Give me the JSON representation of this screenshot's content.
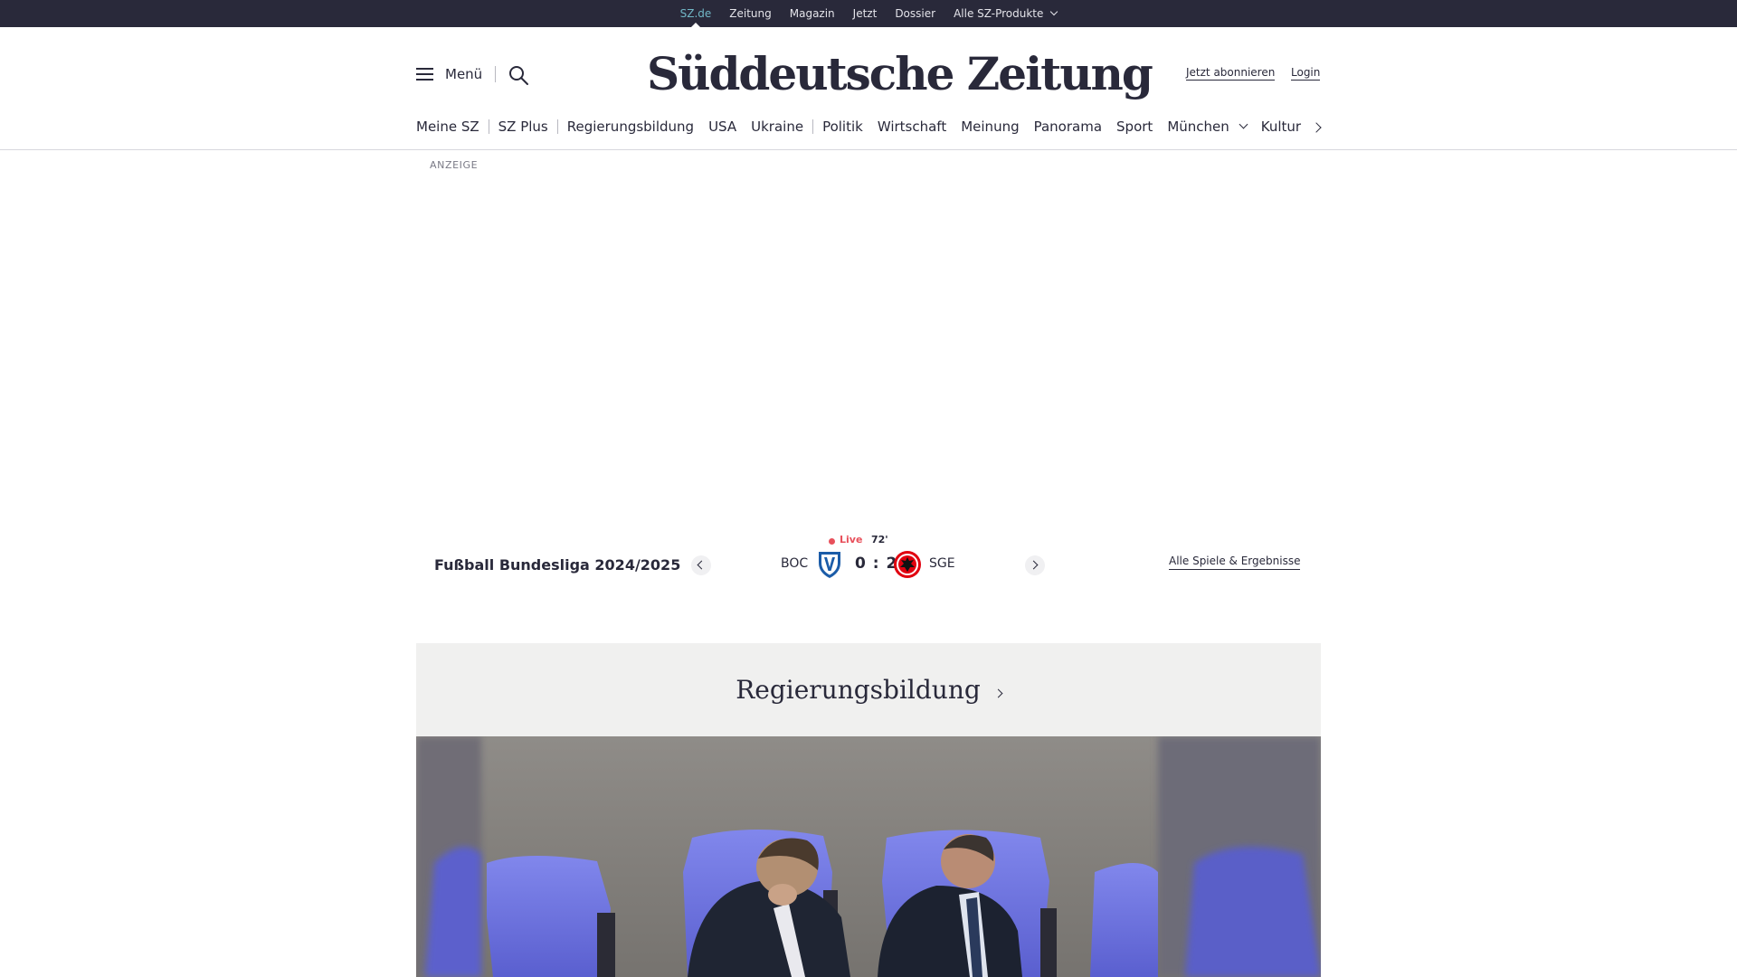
{
  "topbar": {
    "links": [
      {
        "label": "SZ.de"
      },
      {
        "label": "Zeitung"
      },
      {
        "label": "Magazin"
      },
      {
        "label": "Jetzt"
      },
      {
        "label": "Dossier"
      },
      {
        "label": "Alle SZ-Produkte"
      }
    ]
  },
  "header": {
    "menu_label": "Menü",
    "logo": "Süddeutsche Zeitung",
    "subscribe_label": "Jetzt abonnieren",
    "login_label": "Login"
  },
  "nav": {
    "items": [
      {
        "label": "Meine SZ"
      },
      {
        "label": "SZ Plus"
      },
      {
        "label": "Regierungsbildung"
      },
      {
        "label": "USA"
      },
      {
        "label": "Ukraine"
      },
      {
        "label": "Politik"
      },
      {
        "label": "Wirtschaft"
      },
      {
        "label": "Meinung"
      },
      {
        "label": "Panorama"
      },
      {
        "label": "Sport"
      },
      {
        "label": "München"
      },
      {
        "label": "Kultur"
      }
    ]
  },
  "ad": {
    "label": "ANZEIGE"
  },
  "scorebar": {
    "league": "Fußball Bundesliga 2024/2025",
    "live_label": "Live",
    "minute": "72'",
    "home_team": "BOC",
    "away_team": "SGE",
    "score": "0 : 2",
    "all_games_label": "Alle Spiele & Ergebnisse"
  },
  "topic": {
    "title": "Regierungsbildung"
  },
  "colors": {
    "topbar_bg": "#29293a",
    "accent_active": "#71b7c6",
    "live_red": "#e8505b",
    "topic_bg": "#f0f0ef",
    "seat_blue": "#6b72e0"
  }
}
